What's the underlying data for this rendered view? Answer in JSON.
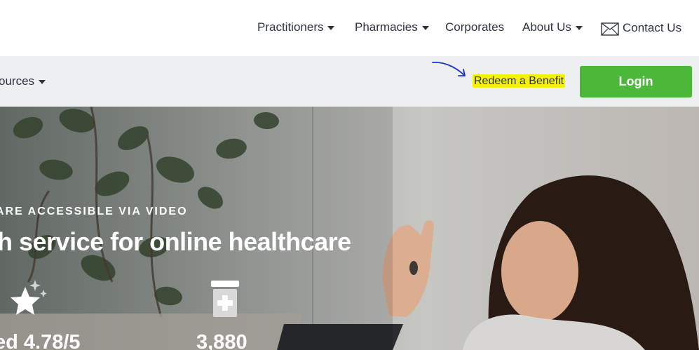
{
  "top_nav": {
    "items": [
      {
        "label": "Practitioners",
        "dropdown": true
      },
      {
        "label": "Pharmacies",
        "dropdown": true
      },
      {
        "label": "Corporates",
        "dropdown": false
      },
      {
        "label": "About Us",
        "dropdown": true
      },
      {
        "label": "Contact Us",
        "icon": "mail-icon"
      }
    ]
  },
  "sub_nav": {
    "resources_label": "ources",
    "redeem_label": "Redeem a Benefit",
    "login_label": "Login"
  },
  "hero": {
    "kicker": "ARE ACCESSIBLE VIA VIDEO",
    "headline": "h service for online healthcare",
    "stats": [
      {
        "icon": "star-icon",
        "value": "ed 4.78/5"
      },
      {
        "icon": "medicine-bottle-icon",
        "value": "3,880"
      }
    ]
  },
  "colors": {
    "login_button": "#4cb83a",
    "highlight": "#f5f20a",
    "subnav_bg": "#eeeff1",
    "text": "#2e3340"
  }
}
